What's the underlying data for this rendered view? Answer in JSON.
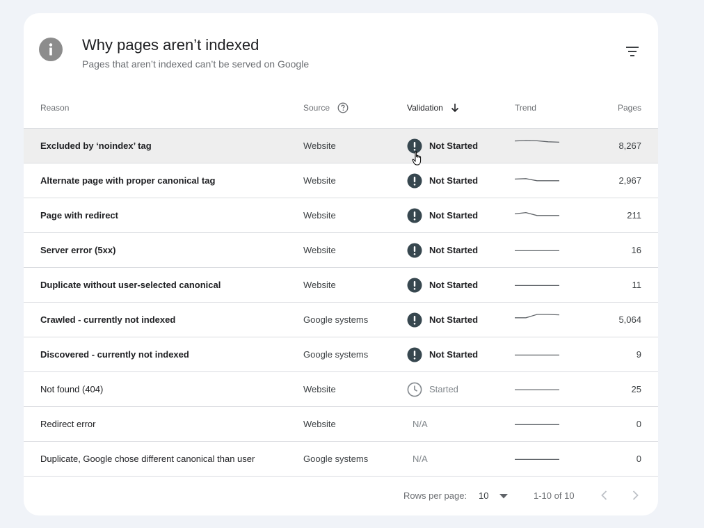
{
  "header": {
    "title": "Why pages aren’t indexed",
    "subtitle": "Pages that aren’t indexed can’t be served on Google",
    "info_icon": "info-icon",
    "filter_icon": "filter-icon"
  },
  "columns": {
    "reason": "Reason",
    "source": "Source",
    "validation": "Validation",
    "trend": "Trend",
    "pages": "Pages"
  },
  "rows": [
    {
      "reason": "Excluded by ‘noindex’ tag",
      "source": "Website",
      "validation": "Not Started",
      "status": "not-started",
      "trend": [
        0.7,
        0.75,
        0.72,
        0.6,
        0.55
      ],
      "pages": "8,267"
    },
    {
      "reason": "Alternate page with proper canonical tag",
      "source": "Website",
      "validation": "Not Started",
      "status": "not-started",
      "trend": [
        0.3,
        0.35,
        0.1,
        0.1,
        0.1
      ],
      "pages": "2,967"
    },
    {
      "reason": "Page with redirect",
      "source": "Website",
      "validation": "Not Started",
      "status": "not-started",
      "trend": [
        0.3,
        0.45,
        0.1,
        0.1,
        0.1
      ],
      "pages": "211"
    },
    {
      "reason": "Server error (5xx)",
      "source": "Website",
      "validation": "Not Started",
      "status": "not-started",
      "trend": [
        0.05,
        0.05,
        0.05,
        0.05,
        0.05
      ],
      "pages": "16"
    },
    {
      "reason": "Duplicate without user-selected canonical",
      "source": "Website",
      "validation": "Not Started",
      "status": "not-started",
      "trend": [
        0.05,
        0.05,
        0.05,
        0.05,
        0.05
      ],
      "pages": "11"
    },
    {
      "reason": "Crawled - currently not indexed",
      "source": "Google systems",
      "validation": "Not Started",
      "status": "not-started",
      "trend": [
        0.35,
        0.35,
        0.75,
        0.75,
        0.7
      ],
      "pages": "5,064"
    },
    {
      "reason": "Discovered - currently not indexed",
      "source": "Google systems",
      "validation": "Not Started",
      "status": "not-started",
      "trend": [
        0.05,
        0.05,
        0.05,
        0.05,
        0.05
      ],
      "pages": "9"
    },
    {
      "reason": "Not found (404)",
      "source": "Website",
      "validation": "Started",
      "status": "started",
      "trend": [
        0.05,
        0.05,
        0.05,
        0.05,
        0.05
      ],
      "pages": "25"
    },
    {
      "reason": "Redirect error",
      "source": "Website",
      "validation": "N/A",
      "status": "na",
      "trend": [
        0.05,
        0.05,
        0.05,
        0.05,
        0.05
      ],
      "pages": "0"
    },
    {
      "reason": "Duplicate, Google chose different canonical than user",
      "source": "Google systems",
      "validation": "N/A",
      "status": "na",
      "trend": [
        0.05,
        0.05,
        0.05,
        0.05,
        0.05
      ],
      "pages": "0"
    }
  ],
  "footer": {
    "rows_per_page_label": "Rows per page:",
    "rows_per_page_value": "10",
    "range": "1-10 of 10"
  },
  "colors": {
    "not_started_icon": "#37474f",
    "trend_line": "#5f6368",
    "started_icon": "#80868b"
  }
}
